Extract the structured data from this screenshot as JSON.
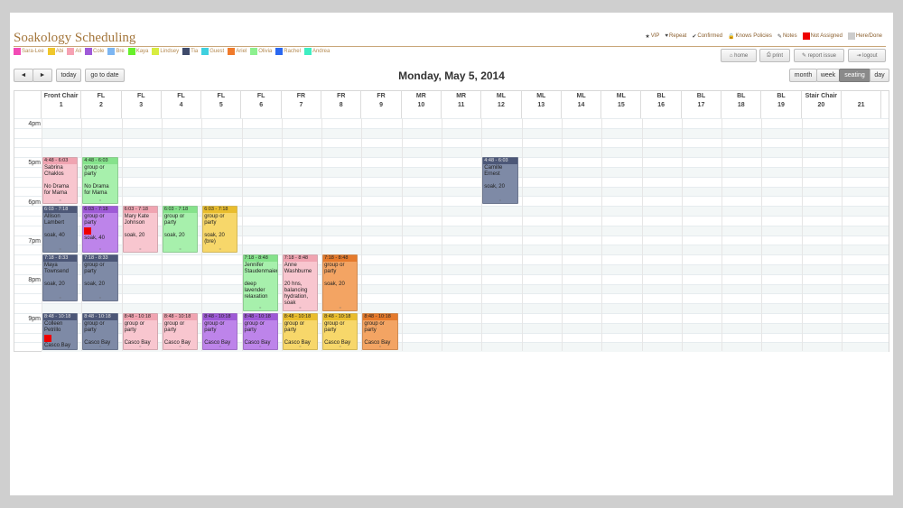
{
  "app": {
    "title": "Soakology Scheduling"
  },
  "legend_keys": [
    {
      "label": "VIP",
      "icon": "star-icon",
      "color": "#444444"
    },
    {
      "label": "Repeat",
      "icon": "heart-icon",
      "color": "#444444"
    },
    {
      "label": "Confirmed",
      "icon": "check-icon",
      "color": "#444444"
    },
    {
      "label": "Knows Policies",
      "icon": "lock-icon",
      "color": "#444444"
    },
    {
      "label": "Notes",
      "icon": "note-icon",
      "color": "#444444"
    },
    {
      "label": "Not Assigned",
      "icon": "swatch",
      "color": "#ee0000"
    },
    {
      "label": "Here/Done",
      "icon": "swatch",
      "color": "#cccccc"
    }
  ],
  "staff": [
    {
      "name": "Sara-Lee",
      "color": "#f24bb5"
    },
    {
      "name": "Abi",
      "color": "#f0c72b"
    },
    {
      "name": "Ali",
      "color": "#f6a2b3"
    },
    {
      "name": "Cole",
      "color": "#9f5ad8"
    },
    {
      "name": "Bre",
      "color": "#7db6f2"
    },
    {
      "name": "Kaya",
      "color": "#68f02b"
    },
    {
      "name": "Lindsey",
      "color": "#d8ed40"
    },
    {
      "name": "Tia",
      "color": "#3f4b6b"
    },
    {
      "name": "Guest",
      "color": "#3fd0df"
    },
    {
      "name": "Ariel",
      "color": "#f07a2b"
    },
    {
      "name": "Olivia",
      "color": "#8df08f"
    },
    {
      "name": "Rachel",
      "color": "#2b68f0"
    },
    {
      "name": "Andrea",
      "color": "#3feec2"
    }
  ],
  "toolbar": {
    "prev": "◄",
    "next": "►",
    "today": "today",
    "goto": "go to date",
    "home": "home",
    "print": "print",
    "report": "report issue",
    "logout": "logout",
    "month": "month",
    "week": "week",
    "seating": "seating",
    "day": "day"
  },
  "date_title": "Monday, May 5, 2014",
  "columns": [
    {
      "name": "Front Chair",
      "num": "1"
    },
    {
      "name": "FL",
      "num": "2"
    },
    {
      "name": "FL",
      "num": "3"
    },
    {
      "name": "FL",
      "num": "4"
    },
    {
      "name": "FL",
      "num": "5"
    },
    {
      "name": "FL",
      "num": "6"
    },
    {
      "name": "FR",
      "num": "7"
    },
    {
      "name": "FR",
      "num": "8"
    },
    {
      "name": "FR",
      "num": "9"
    },
    {
      "name": "MR",
      "num": "10"
    },
    {
      "name": "MR",
      "num": "11"
    },
    {
      "name": "ML",
      "num": "12"
    },
    {
      "name": "ML",
      "num": "13"
    },
    {
      "name": "ML",
      "num": "14"
    },
    {
      "name": "ML",
      "num": "15"
    },
    {
      "name": "BL",
      "num": "16"
    },
    {
      "name": "BL",
      "num": "17"
    },
    {
      "name": "BL",
      "num": "18"
    },
    {
      "name": "BL",
      "num": "19"
    },
    {
      "name": "Stair Chair",
      "num": "20"
    },
    {
      "name": "",
      "num": "21"
    }
  ],
  "times": [
    "4pm",
    "5pm",
    "6pm",
    "7pm",
    "8pm",
    "9pm"
  ],
  "appointments": [
    {
      "col": 1,
      "start": "16:48",
      "end": "18:03",
      "time": "4:48 - 6:03",
      "name": "Sabrina Chaklos",
      "note": "No Drama for Mama",
      "color": "pink",
      "flag": false
    },
    {
      "col": 2,
      "start": "16:48",
      "end": "18:03",
      "time": "4:48 - 6:03",
      "name": "group or party",
      "note": "No Drama for Mama",
      "color": "green",
      "flag": false
    },
    {
      "col": 12,
      "start": "16:48",
      "end": "18:03",
      "time": "4:48 - 6:03",
      "name": "Camille Ernest",
      "note": "soak, 20",
      "color": "slate",
      "flag": false
    },
    {
      "col": 1,
      "start": "18:03",
      "end": "19:18",
      "time": "6:03 - 7:18",
      "name": "Allison Lambert",
      "note": "soak, 40",
      "color": "slate",
      "flag": false
    },
    {
      "col": 2,
      "start": "18:03",
      "end": "19:18",
      "time": "6:03 - 7:18",
      "name": "group or party",
      "note": "soak, 40",
      "color": "purple",
      "flag": true
    },
    {
      "col": 3,
      "start": "18:03",
      "end": "19:18",
      "time": "6:03 - 7:18",
      "name": "Mary Kate Johnson",
      "note": "soak, 20",
      "color": "pink",
      "flag": false
    },
    {
      "col": 4,
      "start": "18:03",
      "end": "19:18",
      "time": "6:03 - 7:18",
      "name": "group or party",
      "note": "soak, 20",
      "color": "green",
      "flag": false
    },
    {
      "col": 5,
      "start": "18:03",
      "end": "19:18",
      "time": "6:03 - 7:18",
      "name": "group or party",
      "note": "soak, 20 (bre)",
      "color": "yellow",
      "flag": false
    },
    {
      "col": 1,
      "start": "19:18",
      "end": "20:33",
      "time": "7:18 - 8:33",
      "name": "Maya Townsend",
      "note": "soak, 20",
      "color": "slate",
      "flag": false
    },
    {
      "col": 2,
      "start": "19:18",
      "end": "20:33",
      "time": "7:18 - 8:33",
      "name": "group or party",
      "note": "soak, 20",
      "color": "slate",
      "flag": false
    },
    {
      "col": 6,
      "start": "19:18",
      "end": "20:48",
      "time": "7:18 - 8:48",
      "name": "Jennifer Staudenmaier",
      "note": "deep lavender relaxation",
      "color": "green",
      "flag": false
    },
    {
      "col": 7,
      "start": "19:18",
      "end": "20:48",
      "time": "7:18 - 8:48",
      "name": "Anne Washburne",
      "note": "20 hns, balancing hydration, soak",
      "color": "pink",
      "flag": false
    },
    {
      "col": 8,
      "start": "19:18",
      "end": "20:48",
      "time": "7:18 - 8:48",
      "name": "group or party",
      "note": "soak, 20",
      "color": "orange",
      "flag": false
    },
    {
      "col": 1,
      "start": "20:48",
      "end": "22:18",
      "time": "8:48 - 10:18",
      "name": "Colleen Petrillo",
      "note": "Casco Bay",
      "color": "slate",
      "flag": true
    },
    {
      "col": 2,
      "start": "20:48",
      "end": "22:18",
      "time": "8:48 - 10:18",
      "name": "group or party",
      "note": "Casco Bay",
      "color": "slate",
      "flag": false
    },
    {
      "col": 3,
      "start": "20:48",
      "end": "22:18",
      "time": "8:48 - 10:18",
      "name": "group or party",
      "note": "Casco Bay",
      "color": "pink",
      "flag": false
    },
    {
      "col": 4,
      "start": "20:48",
      "end": "22:18",
      "time": "8:48 - 10:18",
      "name": "group or party",
      "note": "Casco Bay",
      "color": "pink",
      "flag": false
    },
    {
      "col": 5,
      "start": "20:48",
      "end": "22:18",
      "time": "8:48 - 10:18",
      "name": "group or party",
      "note": "Casco Bay",
      "color": "purple",
      "flag": false
    },
    {
      "col": 6,
      "start": "20:48",
      "end": "22:18",
      "time": "8:48 - 10:18",
      "name": "group or party",
      "note": "Casco Bay",
      "color": "purple",
      "flag": false
    },
    {
      "col": 7,
      "start": "20:48",
      "end": "22:18",
      "time": "8:48 - 10:18",
      "name": "group or party",
      "note": "Casco Bay",
      "color": "yellow",
      "flag": false
    },
    {
      "col": 8,
      "start": "20:48",
      "end": "22:18",
      "time": "8:48 - 10:18",
      "name": "group or party",
      "note": "Casco Bay",
      "color": "yellow",
      "flag": false
    },
    {
      "col": 9,
      "start": "20:48",
      "end": "22:18",
      "time": "8:48 - 10:18",
      "name": "group or party",
      "note": "Casco Bay",
      "color": "orange",
      "flag": false
    }
  ]
}
